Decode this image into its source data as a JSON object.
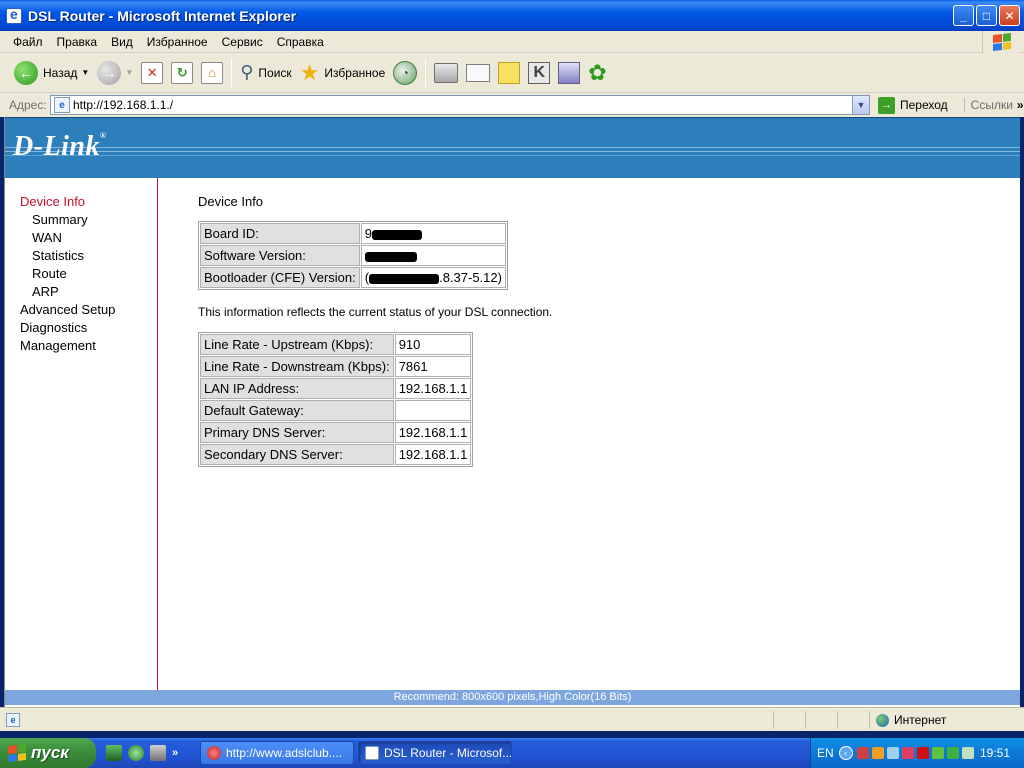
{
  "window": {
    "title": "DSL Router - Microsoft Internet Explorer"
  },
  "menu": [
    "Файл",
    "Правка",
    "Вид",
    "Избранное",
    "Сервис",
    "Справка"
  ],
  "toolbar": {
    "back_label": "Назад",
    "search_label": "Поиск",
    "favorites_label": "Избранное"
  },
  "address": {
    "label": "Адрес:",
    "url": "http://192.168.1.1./",
    "go_label": "Переход",
    "links_label": "Ссылки"
  },
  "brand": {
    "logo": "D-Link"
  },
  "sidebar": {
    "items": [
      {
        "label": "Device Info",
        "active": true
      },
      {
        "label": "Summary",
        "sub": true
      },
      {
        "label": "WAN",
        "sub": true
      },
      {
        "label": "Statistics",
        "sub": true
      },
      {
        "label": "Route",
        "sub": true
      },
      {
        "label": "ARP",
        "sub": true
      },
      {
        "label": "Advanced Setup"
      },
      {
        "label": "Diagnostics"
      },
      {
        "label": "Management"
      }
    ]
  },
  "main": {
    "title": "Device Info",
    "device_table": [
      {
        "label": "Board ID:",
        "value_visible": "9"
      },
      {
        "label": "Software Version:",
        "value_visible": ""
      },
      {
        "label": "Bootloader (CFE) Version:",
        "value_visible": "(",
        "value_suffix": ".8.37-5.12)"
      }
    ],
    "note": "This information reflects the current status of your DSL connection.",
    "status_table": [
      {
        "label": "Line Rate - Upstream (Kbps):",
        "value": "910"
      },
      {
        "label": "Line Rate - Downstream (Kbps):",
        "value": "7861"
      },
      {
        "label": "LAN IP Address:",
        "value": "192.168.1.1"
      },
      {
        "label": "Default Gateway:",
        "value": ""
      },
      {
        "label": "Primary DNS Server:",
        "value": "192.168.1.1"
      },
      {
        "label": "Secondary DNS Server:",
        "value": "192.168.1.1"
      }
    ],
    "recommend": "Recommend: 800x600 pixels,High Color(16 Bits)"
  },
  "statusbar": {
    "zone": "Интернет"
  },
  "taskbar": {
    "start_label": "пуск",
    "tasks": [
      {
        "label": "http://www.adslclub....",
        "active": false
      },
      {
        "label": "DSL Router - Microsof...",
        "active": true
      }
    ],
    "lang": "EN",
    "clock": "19:51"
  },
  "colors": {
    "accent": "#c8102e",
    "banner": "#2d7fbc",
    "titlebar": "#0058e6"
  }
}
